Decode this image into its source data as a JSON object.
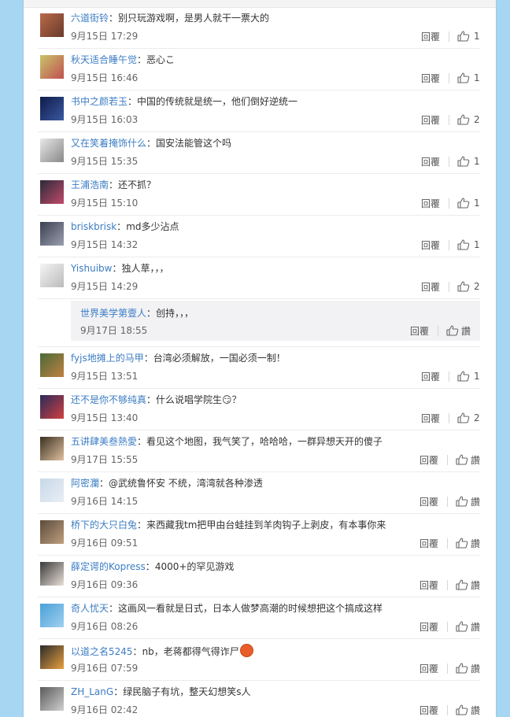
{
  "reply_label": "回覆",
  "like_label": "讚",
  "comments": [
    {
      "user": "六道街铃",
      "text": "别只玩游戏啊，是男人就干一票大的",
      "time": "9月15日 17:29",
      "likes": "1",
      "avatar": "#b86a4a",
      "avatar2": "#6a3a2a"
    },
    {
      "user": "秋天适合睡午觉",
      "text": "恶心こ",
      "time": "9月15日 16:46",
      "likes": "1",
      "avatar": "#c9c46a",
      "avatar2": "#c05050"
    },
    {
      "user": "书中之颜若玉",
      "text": "中国的传统就是统一，他们倒好逆统一",
      "time": "9月15日 16:03",
      "likes": "2",
      "avatar": "#0f1a4a",
      "avatar2": "#3a5aa0"
    },
    {
      "user": "又在笑着掩饰什么",
      "text": "国安法能管这个吗",
      "time": "9月15日 15:35",
      "likes": "1",
      "avatar": "#e8e8e8",
      "avatar2": "#888888"
    },
    {
      "user": "王浦浩南",
      "text": "还不抓？",
      "time": "9月15日 15:10",
      "likes": "1",
      "avatar": "#2a2a3a",
      "avatar2": "#c04a6a"
    },
    {
      "user": "briskbrisk",
      "text": "md多少沾点",
      "time": "9月15日 14:32",
      "likes": "1",
      "avatar": "#3a4050",
      "avatar2": "#9aa0b0"
    },
    {
      "user": "Yishuibw",
      "text": "独人草，，，",
      "time": "9月15日 14:29",
      "likes": "2",
      "avatar": "#f4f4f4",
      "avatar2": "#bbbbbb"
    }
  ],
  "sub_reply": {
    "user": "世界美学第壹人",
    "text": "创持，，，",
    "time": "9月17日 18:55",
    "likes": ""
  },
  "comments2": [
    {
      "user": "fyjs地摊上的马甲",
      "text": "台湾必须解放，一国必须一制！",
      "time": "9月15日 13:51",
      "likes": "1",
      "avatar": "#4a6a3a",
      "avatar2": "#c08040"
    },
    {
      "user": "还不是你不够纯真",
      "text": "什么说唱学院生😏？",
      "time": "9月15日 13:40",
      "likes": "2",
      "avatar": "#2a2a5a",
      "avatar2": "#d04040"
    },
    {
      "user": "五讲肆美叁熱愛",
      "text": "看见这个地图，我气笑了，哈哈哈，一群异想天开的傻子",
      "time": "9月17日 15:55",
      "likes": "",
      "avatar": "#3a3020",
      "avatar2": "#e0c0a0"
    },
    {
      "user": "阿密瀾",
      "text": "@武统鲁怀安 不统，湾湾就各种渗透",
      "time": "9月16日 14:15",
      "likes": "",
      "avatar": "#c8d8e8",
      "avatar2": "#e8eef4"
    },
    {
      "user": "桥下的大只白兔",
      "text": "来西藏我tm把甲由台蛙挂到羊肉钩子上剥皮，有本事你来",
      "time": "9月16日 09:51",
      "likes": "",
      "avatar": "#5a4a3a",
      "avatar2": "#c0a080"
    },
    {
      "user": "薛定谔的Kopress",
      "text": "4000+的罕见游戏",
      "time": "9月16日 09:36",
      "likes": "",
      "avatar": "#3a3a3a",
      "avatar2": "#e8e0d8"
    },
    {
      "user": "奇人忧天",
      "text": "这画风一看就是日式，日本人做梦高潮的时候想把这个搞成这样",
      "time": "9月16日 08:26",
      "likes": "",
      "avatar": "#4aa0d8",
      "avatar2": "#a0d0f0"
    },
    {
      "user": "以道之名5245",
      "text": "nb，老蒋都得气得诈尸",
      "time": "9月16日 07:59",
      "likes": "",
      "avatar": "#2a2a2a",
      "avatar2": "#e8a040"
    },
    {
      "user": "ZH_LanG",
      "text": "绿民脑子有坑，整天幻想笑s人",
      "time": "9月16日 02:42",
      "likes": "",
      "avatar": "#5a5a5a",
      "avatar2": "#d0d0d0"
    }
  ]
}
